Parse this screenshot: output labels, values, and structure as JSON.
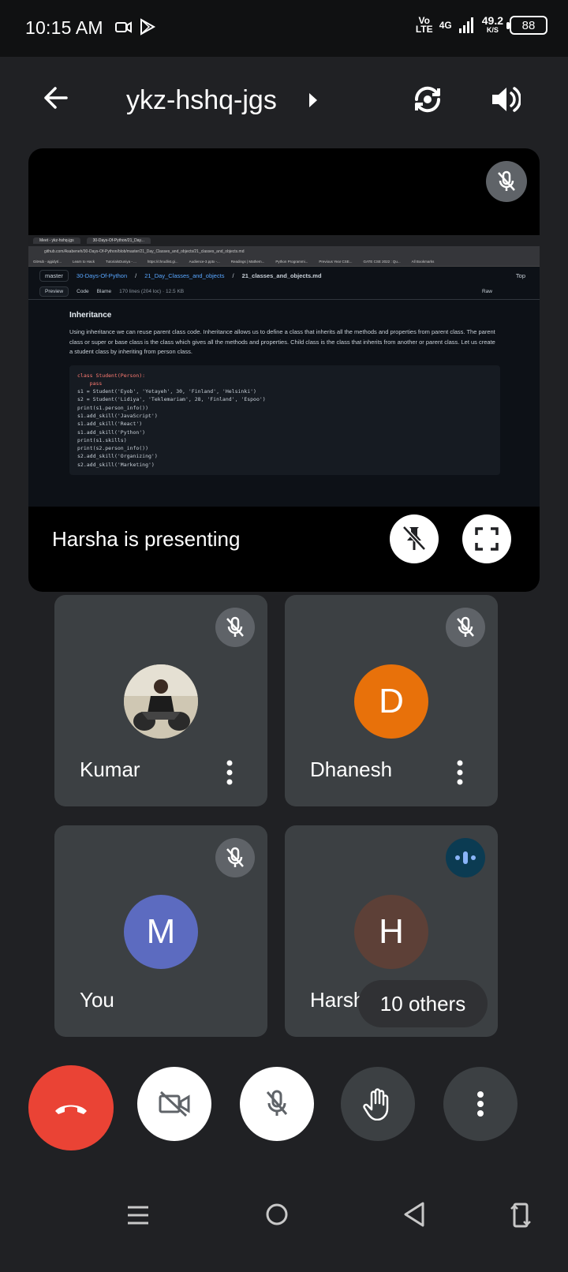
{
  "status_bar": {
    "time": "10:15 AM",
    "network_label": "Vo LTE",
    "network_type": "4G",
    "speed_value": "49.2",
    "speed_unit": "K/S",
    "battery": "88"
  },
  "header": {
    "meeting_code": "ykz-hshq-jgs"
  },
  "presentation": {
    "status_text": "Harsha is presenting",
    "screen": {
      "tab_1": "Meet - ykz-hshq-jgs",
      "tab_2": "30-Days-Of-Python/21_Day...",
      "url": "github.com/Asabeneh/30-Days-Of-Python/blob/master/21_Day_Classes_and_objects/21_classes_and_objects.md",
      "bookmarks": [
        "GitHub - ajgidyt/...",
        "Learn to Hack",
        "TutorialsDuniya - ...",
        "https://chrudlist.gi...",
        "Audience-3.pptx -...",
        "Readings | Mathem...",
        "Python Programmi...",
        "Previous Year CSE...",
        "GATE CSE 2022 : Qu...",
        "All Bookmarks"
      ],
      "branch": "master",
      "path_repo": "30-Days-Of-Python",
      "path_dir": "21_Day_Classes_and_objects",
      "path_file": "21_classes_and_objects.md",
      "top_label": "Top",
      "tab_preview": "Preview",
      "tab_code": "Code",
      "tab_blame": "Blame",
      "file_info": "170 lines (204 loc) · 12.5 KB",
      "raw_label": "Raw",
      "heading": "Inheritance",
      "paragraph": "Using inheritance we can reuse parent class code. Inheritance allows us to define a class that inherits all the methods and properties from parent class. The parent class or super or base class is the class which gives all the methods and properties. Child class is the class that inherits from another or parent class. Let us create a student class by inheriting from person class.",
      "code_lines": [
        "class Student(Person):",
        "    pass",
        "",
        "",
        "s1 = Student('Eyob', 'Yetayeh', 30, 'Finland', 'Helsinki')",
        "s2 = Student('Lidiya', 'Teklemariam', 28, 'Finland', 'Espoo')",
        "print(s1.person_info())",
        "s1.add_skill('JavaScript')",
        "s1.add_skill('React')",
        "s1.add_skill('Python')",
        "print(s1.skills)",
        "",
        "print(s2.person_info())",
        "s2.add_skill('Organizing')",
        "s2.add_skill('Marketing')"
      ]
    }
  },
  "participants": [
    {
      "name": "Kumar",
      "avatar_type": "photo",
      "muted": true
    },
    {
      "name": "Dhanesh",
      "initial": "D",
      "avatar_color": "#e8710a",
      "muted": true
    },
    {
      "name": "You",
      "initial": "M",
      "avatar_color": "#5c6bc0",
      "muted": true
    },
    {
      "name": "Harsha",
      "initial": "H",
      "avatar_color": "#5d4037",
      "speaking": true
    }
  ],
  "others_label": "10 others",
  "colors": {
    "end_call": "#ea4335",
    "background": "#202124",
    "tile": "#3c4043"
  }
}
